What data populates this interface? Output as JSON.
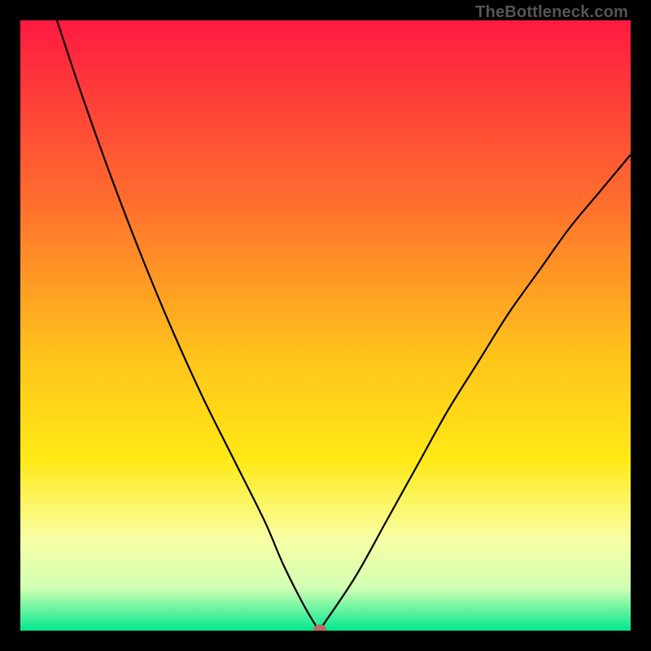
{
  "watermark": "TheBottleneck.com",
  "colors": {
    "top": "#fe1a41",
    "mid_upper": "#ff6f2e",
    "mid": "#ffc31b",
    "mid_lower": "#ffe916",
    "pale": "#f8ffa5",
    "low": "#d1ffb3",
    "bottom": "#02e88f",
    "curve": "#000000",
    "marker": "#bb6d64",
    "frame": "#000000"
  },
  "chart_data": {
    "type": "line",
    "title": "",
    "xlabel": "",
    "ylabel": "",
    "xlim": [
      0,
      100
    ],
    "ylim": [
      0,
      100
    ],
    "series": [
      {
        "name": "bottleneck-curve",
        "x": [
          6,
          10,
          15,
          20,
          25,
          30,
          35,
          40,
          43,
          46,
          48,
          49,
          50,
          55,
          60,
          65,
          70,
          75,
          80,
          85,
          90,
          95,
          100
        ],
        "y": [
          100,
          88,
          74,
          61,
          49,
          38,
          28,
          18,
          11,
          5,
          1.5,
          0.3,
          1.5,
          9,
          18,
          27,
          36,
          44,
          52,
          59,
          66,
          72,
          78
        ]
      }
    ],
    "marker": {
      "x": 49,
      "y": 0.3
    },
    "gradient_stops": [
      {
        "pct": 0,
        "color": "#fe1a41"
      },
      {
        "pct": 30,
        "color": "#ff6f2e"
      },
      {
        "pct": 55,
        "color": "#ffc31b"
      },
      {
        "pct": 72,
        "color": "#ffe916"
      },
      {
        "pct": 85,
        "color": "#f8ffa5"
      },
      {
        "pct": 93,
        "color": "#d1ffb3"
      },
      {
        "pct": 100,
        "color": "#02e88f"
      }
    ]
  }
}
